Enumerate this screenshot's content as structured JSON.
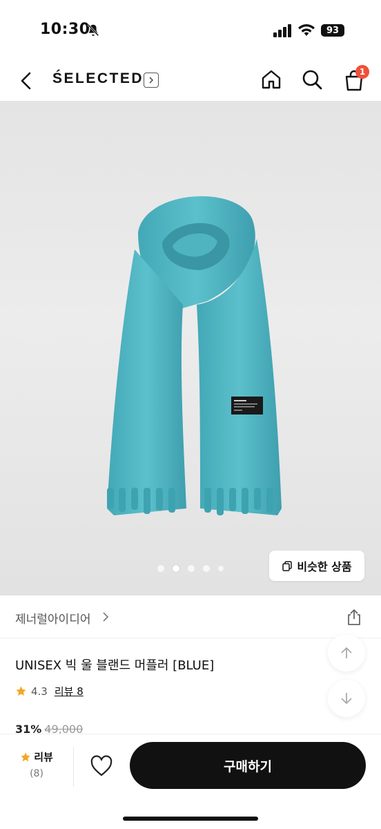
{
  "status_bar": {
    "time": "10:30",
    "battery": "93"
  },
  "header": {
    "brand": "ŚELECTED",
    "cart_count": "1"
  },
  "gallery": {
    "image_count": 5,
    "active_index": 1,
    "similar_button": "비슷한 상품"
  },
  "seller": {
    "name": "제너럴아이디어"
  },
  "product": {
    "title": "UNISEX 빅 울 블랜드 머플러 [BLUE]",
    "rating": "4.3",
    "review_link": "리뷰 8",
    "discount": "31%",
    "original_price": "49,000"
  },
  "bottom_bar": {
    "review_label": "리뷰",
    "review_count": "(8)",
    "buy_label": "구매하기"
  },
  "colors": {
    "accent_star": "#f5a623",
    "badge": "#f0503a",
    "scarf": "#4fb3c0"
  }
}
